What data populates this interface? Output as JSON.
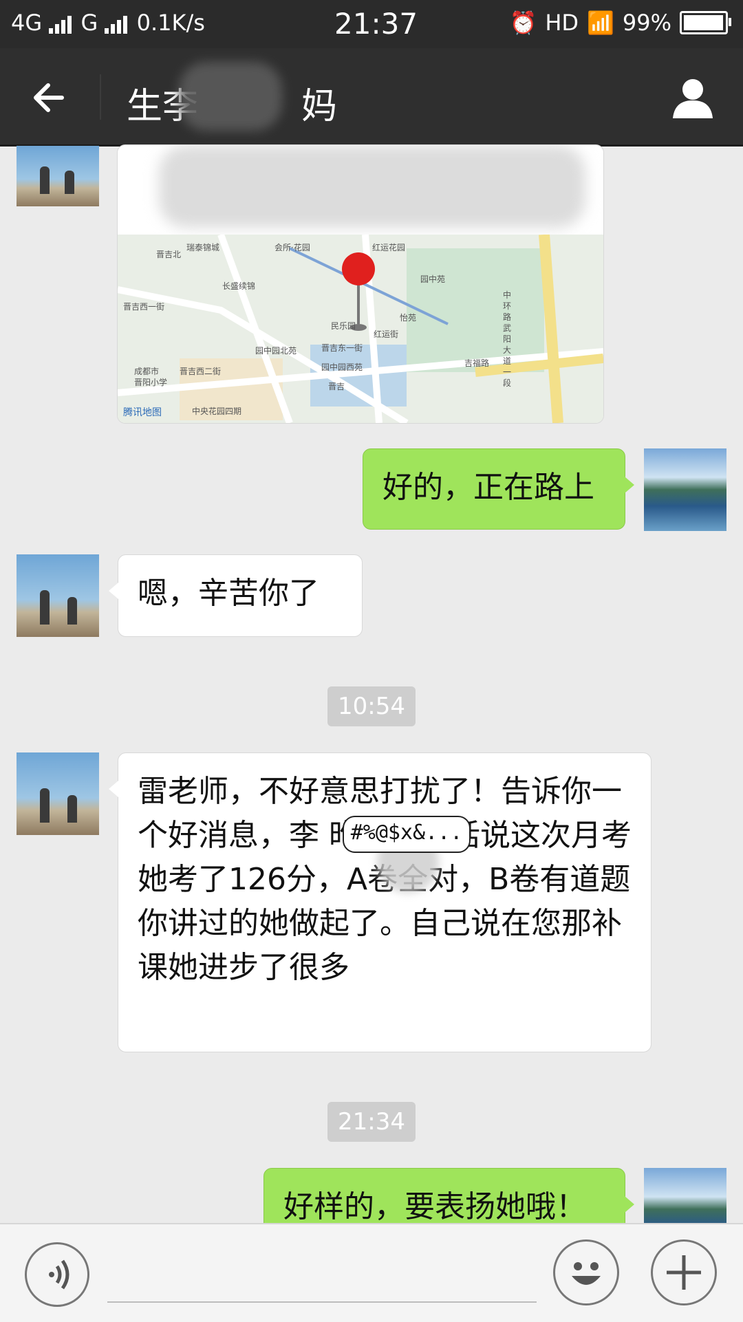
{
  "status_bar": {
    "network": "4G",
    "network2": "G",
    "speed": "0.1K/s",
    "time": "21:37",
    "hd": "HD",
    "battery": "99%",
    "battery_level": 0.99
  },
  "header": {
    "title": "生李",
    "title_suffix": "妈",
    "profile_icon": "person-icon",
    "back_icon": "arrow-left-icon"
  },
  "map": {
    "labels": [
      "瑞泰锦城",
      "会所·花园",
      "红运花园",
      "园中苑",
      "长盛续锦",
      "晋吉西一街",
      "民乐园",
      "怡苑",
      "园中园北苑",
      "晋吉东一街",
      "红运街",
      "园中园西苑",
      "晋吉西二街",
      "成都市",
      "晋阳小学",
      "晋吉北",
      "吉福路",
      "中央花园四期",
      "晋吉",
      "中环路武阳大道一段"
    ],
    "credit": "腾讯地图"
  },
  "messages": [
    {
      "side": "out",
      "text": "好的，正在路上"
    },
    {
      "side": "in",
      "text": "嗯，辛苦你了"
    },
    {
      "side": "time",
      "text": "10:54"
    },
    {
      "side": "in",
      "text": "雷老师，不好意思打扰了！告诉你一个好消息，李        昨天打电话说这次月考她考了126分，A卷全对，B卷有道题你讲过的她做起了。自己说在您那补课她进步了很多"
    },
    {
      "side": "time",
      "text": "21:34"
    },
    {
      "side": "out",
      "text": "好样的，要表扬她哦！"
    }
  ],
  "scribble_text": "#%@$x&...",
  "bottom": {
    "voice_icon": "voice-icon",
    "emoji_icon": "emoji-icon",
    "plus_icon": "plus-icon"
  }
}
